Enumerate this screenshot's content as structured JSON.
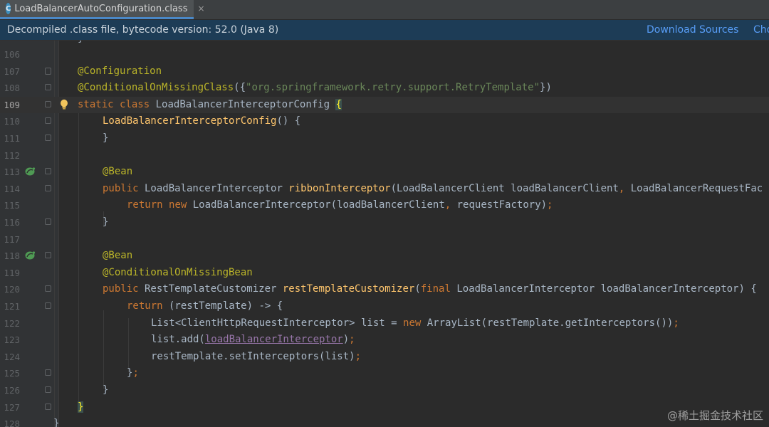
{
  "tab": {
    "file_icon": "class-file-icon",
    "label": "LoadBalancerAutoConfiguration.class",
    "close": "×"
  },
  "banner": {
    "text": "Decompiled .class file, bytecode version: 52.0 (Java 8)",
    "download_sources": "Download Sources",
    "choose_sources": "Cho"
  },
  "gutter": {
    "line_numbers": [
      "106",
      "107",
      "108",
      "109",
      "110",
      "111",
      "112",
      "113",
      "114",
      "115",
      "116",
      "117",
      "118",
      "119",
      "120",
      "121",
      "122",
      "123",
      "124",
      "125",
      "126",
      "127",
      "128"
    ],
    "current_line": "109",
    "icons": [
      "intention-bulb-icon",
      "spring-bean-icon"
    ]
  },
  "code": {
    "l105_brace": "}",
    "l107_annotation": "@Configuration",
    "l108_annotation": "@ConditionalOnMissingClass",
    "l108_open": "({",
    "l108_string": "\"org.springframework.retry.support.RetryTemplate\"",
    "l108_close": "})",
    "l109_static": "static",
    "l109_class": "class",
    "l109_name": "LoadBalancerInterceptorConfig ",
    "l109_brace": "{",
    "l110_ctor": "LoadBalancerInterceptorConfig",
    "l110_rest": "() {",
    "l111": "}",
    "l113_annotation": "@Bean",
    "l114_public": "public",
    "l114_type": " LoadBalancerInterceptor ",
    "l114_method": "ribbonInterceptor",
    "l114_params": "(LoadBalancerClient loadBalancerClient",
    "l114_comma": ",",
    "l114_params2": " LoadBalancerRequestFac",
    "l115_return": "return",
    "l115_new": "new",
    "l115_call": " LoadBalancerInterceptor(loadBalancerClient",
    "l115_comma": ",",
    "l115_rest": " requestFactory)",
    "l115_semi": ";",
    "l116": "}",
    "l118_annotation": "@Bean",
    "l119_annotation": "@ConditionalOnMissingBean",
    "l120_public": "public",
    "l120_type": " RestTemplateCustomizer ",
    "l120_method": "restTemplateCustomizer",
    "l120_open": "(",
    "l120_final": "final",
    "l120_rest": " LoadBalancerInterceptor loadBalancerInterceptor) {",
    "l121_return": "return",
    "l121_rest": " (restTemplate) -> {",
    "l122_a": "List<ClientHttpRequestInterceptor> list = ",
    "l122_new": "new",
    "l122_b": " ArrayList(restTemplate.getInterceptors())",
    "l122_semi": ";",
    "l123_a": "list.add(",
    "l123_field": "loadBalancerInterceptor",
    "l123_b": ")",
    "l123_semi": ";",
    "l124_a": "restTemplate.setInterceptors(list)",
    "l124_semi": ";",
    "l125_brace": "}",
    "l125_semi": ";",
    "l126": "}",
    "l127": "}",
    "l128": "}"
  },
  "watermark": "@稀土掘金技术社区"
}
